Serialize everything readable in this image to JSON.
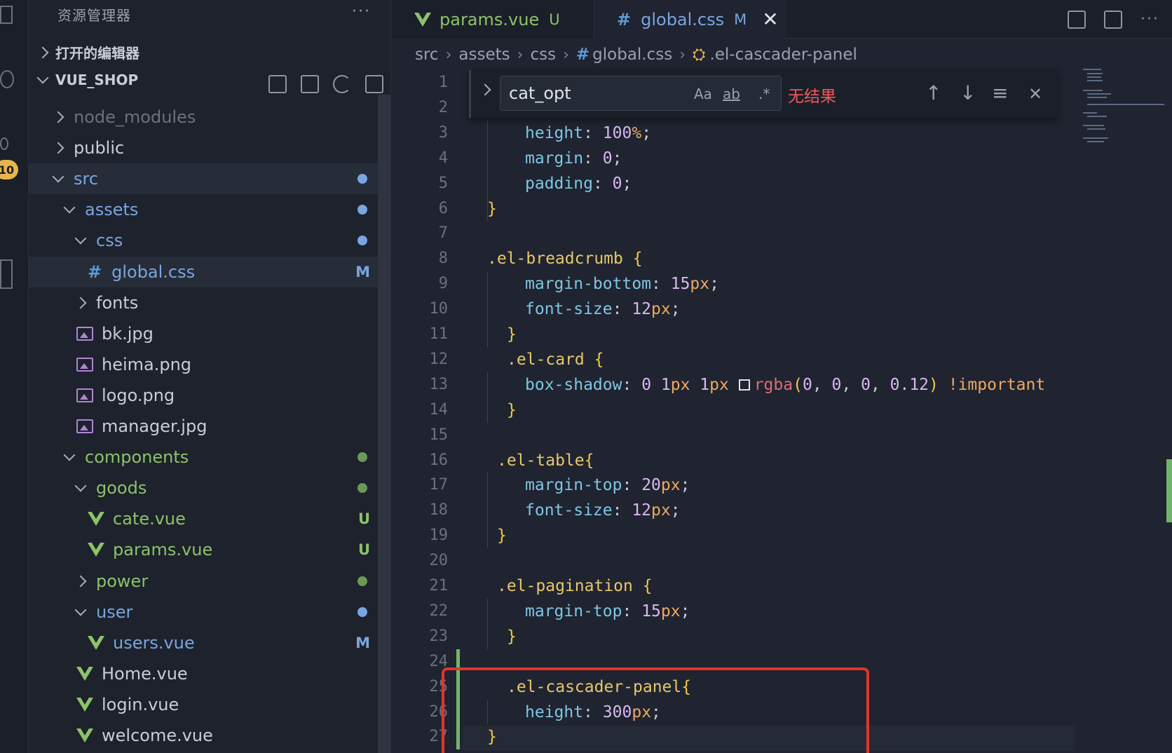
{
  "activity": {
    "badge": "10"
  },
  "sidebar": {
    "title": "资源管理器",
    "more": "···",
    "open_editors": "打开的编辑器",
    "project": "VUE_SHOP",
    "tree": [
      {
        "label": "node_modules",
        "kind": "folder-closed",
        "depth": 1,
        "color": "#6a7180"
      },
      {
        "label": "public",
        "kind": "folder-closed",
        "depth": 1,
        "color": "#c8cdd8"
      },
      {
        "label": "src",
        "kind": "folder-open",
        "depth": 1,
        "color": "#7aa5e0",
        "dot": "#7aa5e0"
      },
      {
        "label": "assets",
        "kind": "folder-open",
        "depth": 2,
        "color": "#7aa5e0",
        "dot": "#7aa5e0"
      },
      {
        "label": "css",
        "kind": "folder-open",
        "depth": 3,
        "color": "#7aa5e0",
        "dot": "#7aa5e0"
      },
      {
        "label": "global.css",
        "kind": "css",
        "depth": 4,
        "color": "#7aa5e0",
        "status": "M"
      },
      {
        "label": "fonts",
        "kind": "folder-closed",
        "depth": 3,
        "color": "#c8cdd8"
      },
      {
        "label": "bk.jpg",
        "kind": "image",
        "depth": 3,
        "color": "#c8cdd8"
      },
      {
        "label": "heima.png",
        "kind": "image",
        "depth": 3,
        "color": "#c8cdd8"
      },
      {
        "label": "logo.png",
        "kind": "image",
        "depth": 3,
        "color": "#c8cdd8"
      },
      {
        "label": "manager.jpg",
        "kind": "image",
        "depth": 3,
        "color": "#c8cdd8"
      },
      {
        "label": "components",
        "kind": "folder-open",
        "depth": 2,
        "color": "#8dc26a",
        "dot": "#6a9a55"
      },
      {
        "label": "goods",
        "kind": "folder-open",
        "depth": 3,
        "color": "#8dc26a",
        "dot": "#6a9a55"
      },
      {
        "label": "cate.vue",
        "kind": "vue",
        "depth": 4,
        "color": "#8dc26a",
        "status": "U"
      },
      {
        "label": "params.vue",
        "kind": "vue",
        "depth": 4,
        "color": "#8dc26a",
        "status": "U"
      },
      {
        "label": "power",
        "kind": "folder-closed",
        "depth": 3,
        "color": "#8dc26a",
        "dot": "#6a9a55"
      },
      {
        "label": "user",
        "kind": "folder-open",
        "depth": 3,
        "color": "#7aa5e0",
        "dot": "#7aa5e0"
      },
      {
        "label": "users.vue",
        "kind": "vue",
        "depth": 4,
        "color": "#7aa5e0",
        "status": "M"
      },
      {
        "label": "Home.vue",
        "kind": "vue",
        "depth": 3,
        "color": "#c8cdd8"
      },
      {
        "label": "login.vue",
        "kind": "vue",
        "depth": 3,
        "color": "#c8cdd8"
      },
      {
        "label": "welcome.vue",
        "kind": "vue",
        "depth": 3,
        "color": "#c8cdd8"
      }
    ]
  },
  "tabs": [
    {
      "label": "params.vue",
      "badge": "U"
    },
    {
      "label": "global.css",
      "badge": "M",
      "close": "✕"
    }
  ],
  "breadcrumb": [
    "src",
    "assets",
    "css",
    "global.css",
    ".el-cascader-panel"
  ],
  "find": {
    "value": "cat_opt",
    "match_case": "Aa",
    "whole_word": "ab",
    "regex": ".*",
    "result": "无结果",
    "prev": "↑",
    "next": "↓",
    "selection": "≡",
    "close": "✕"
  },
  "code": {
    "line_numbers": [
      "1",
      "2",
      "3",
      "4",
      "5",
      "6",
      "7",
      "8",
      "9",
      "10",
      "11",
      "12",
      "13",
      "14",
      "15",
      "16",
      "17",
      "18",
      "19",
      "20",
      "21",
      "22",
      "23",
      "24",
      "25",
      "26",
      "27"
    ],
    "lines": [
      [],
      [],
      [
        {
          "t": "height",
          "c": "prop"
        },
        {
          "t": ": ",
          "c": "punc"
        },
        {
          "t": "100",
          "c": "num"
        },
        {
          "t": "%",
          "c": "unit"
        },
        {
          "t": ";",
          "c": "punc"
        }
      ],
      [
        {
          "t": "margin",
          "c": "prop"
        },
        {
          "t": ": ",
          "c": "punc"
        },
        {
          "t": "0",
          "c": "num"
        },
        {
          "t": ";",
          "c": "punc"
        }
      ],
      [
        {
          "t": "padding",
          "c": "prop"
        },
        {
          "t": ": ",
          "c": "punc"
        },
        {
          "t": "0",
          "c": "num"
        },
        {
          "t": ";",
          "c": "punc"
        }
      ],
      [
        {
          "t": "}",
          "c": "brace"
        }
      ],
      [],
      [
        {
          "t": ".el-breadcrumb ",
          "c": "sel-c"
        },
        {
          "t": "{",
          "c": "brace"
        }
      ],
      [
        {
          "t": "margin-bottom",
          "c": "prop"
        },
        {
          "t": ": ",
          "c": "punc"
        },
        {
          "t": "15",
          "c": "num"
        },
        {
          "t": "px",
          "c": "unit"
        },
        {
          "t": ";",
          "c": "punc"
        }
      ],
      [
        {
          "t": "font-size",
          "c": "prop"
        },
        {
          "t": ": ",
          "c": "punc"
        },
        {
          "t": "12",
          "c": "num"
        },
        {
          "t": "px",
          "c": "unit"
        },
        {
          "t": ";",
          "c": "punc"
        }
      ],
      [
        {
          "t": "}",
          "c": "brace"
        }
      ],
      [
        {
          "t": ".el-card ",
          "c": "sel-c"
        },
        {
          "t": "{",
          "c": "brace"
        }
      ],
      [
        {
          "t": "box-shadow",
          "c": "prop"
        },
        {
          "t": ": ",
          "c": "punc"
        },
        {
          "t": "0 ",
          "c": "num"
        },
        {
          "t": "1",
          "c": "num"
        },
        {
          "t": "px ",
          "c": "unit"
        },
        {
          "t": "1",
          "c": "num"
        },
        {
          "t": "px ",
          "c": "unit"
        },
        {
          "t": "",
          "c": "swatch"
        },
        {
          "t": "rgba",
          "c": "fn"
        },
        {
          "t": "(",
          "c": "brace"
        },
        {
          "t": "0",
          "c": "num"
        },
        {
          "t": ", ",
          "c": "punc"
        },
        {
          "t": "0",
          "c": "num"
        },
        {
          "t": ", ",
          "c": "punc"
        },
        {
          "t": "0",
          "c": "num"
        },
        {
          "t": ", ",
          "c": "punc"
        },
        {
          "t": "0.12",
          "c": "num"
        },
        {
          "t": ") ",
          "c": "brace"
        },
        {
          "t": "!important",
          "c": "imp"
        }
      ],
      [
        {
          "t": "}",
          "c": "brace"
        }
      ],
      [],
      [
        {
          "t": ".el-table",
          "c": "sel-c"
        },
        {
          "t": "{",
          "c": "brace"
        }
      ],
      [
        {
          "t": "margin-top",
          "c": "prop"
        },
        {
          "t": ": ",
          "c": "punc"
        },
        {
          "t": "20",
          "c": "num"
        },
        {
          "t": "px",
          "c": "unit"
        },
        {
          "t": ";",
          "c": "punc"
        }
      ],
      [
        {
          "t": "font-size",
          "c": "prop"
        },
        {
          "t": ": ",
          "c": "punc"
        },
        {
          "t": "12",
          "c": "num"
        },
        {
          "t": "px",
          "c": "unit"
        },
        {
          "t": ";",
          "c": "punc"
        }
      ],
      [
        {
          "t": "}",
          "c": "brace"
        }
      ],
      [],
      [
        {
          "t": ".el-pagination ",
          "c": "sel-c"
        },
        {
          "t": "{",
          "c": "brace"
        }
      ],
      [
        {
          "t": "margin-top",
          "c": "prop"
        },
        {
          "t": ": ",
          "c": "punc"
        },
        {
          "t": "15",
          "c": "num"
        },
        {
          "t": "px",
          "c": "unit"
        },
        {
          "t": ";",
          "c": "punc"
        }
      ],
      [
        {
          "t": "}",
          "c": "brace"
        }
      ],
      [],
      [
        {
          "t": ".el-cascader-panel",
          "c": "sel-c"
        },
        {
          "t": "{",
          "c": "brace"
        }
      ],
      [
        {
          "t": "height",
          "c": "prop"
        },
        {
          "t": ": ",
          "c": "punc"
        },
        {
          "t": "300",
          "c": "num"
        },
        {
          "t": "px",
          "c": "unit"
        },
        {
          "t": ";",
          "c": "punc"
        }
      ],
      [
        {
          "t": "}",
          "c": "brace"
        }
      ]
    ]
  },
  "colors": {
    "accent_blue": "#7aa5e0",
    "vue_green": "#8dc26a",
    "error_red": "#ef5a5a",
    "highlight_red": "#e0352b"
  }
}
